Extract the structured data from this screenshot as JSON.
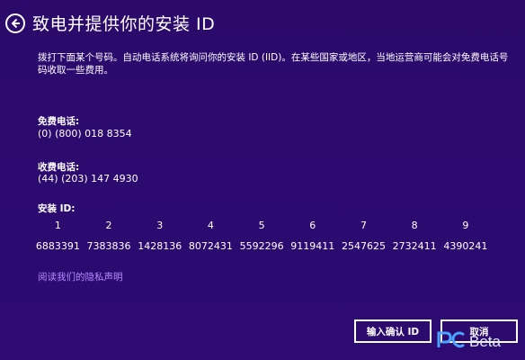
{
  "header": {
    "title": "致电并提供你的安装 ID",
    "back_icon": "back-arrow-icon"
  },
  "instructions": "拨打下面某个号码。自动电话系统将询问你的安装 ID (IID)。在某些国家或地区，当地运营商可能会对免费电话号码收取一些费用。",
  "toll_free": {
    "label": "免费电话:",
    "number": "(0) (800) 018 8354"
  },
  "toll": {
    "label": "收费电话:",
    "number": "(44) (203) 147 4930"
  },
  "installation_id": {
    "label": "安装 ID:",
    "columns": [
      "1",
      "2",
      "3",
      "4",
      "5",
      "6",
      "7",
      "8",
      "9"
    ],
    "groups": [
      "6883391",
      "7383836",
      "1428136",
      "8072431",
      "5592296",
      "9119411",
      "2547625",
      "2732411",
      "4390241"
    ]
  },
  "privacy_link": "阅读我们的隐私声明",
  "buttons": {
    "enter_confirmation_id": "输入确认 ID",
    "cancel": "取消"
  },
  "watermark": {
    "text": "Beta",
    "logo": "pcbeta-logo"
  },
  "colors": {
    "background": "#2c0a6e",
    "link": "#b28bff",
    "text": "#ffffff"
  }
}
